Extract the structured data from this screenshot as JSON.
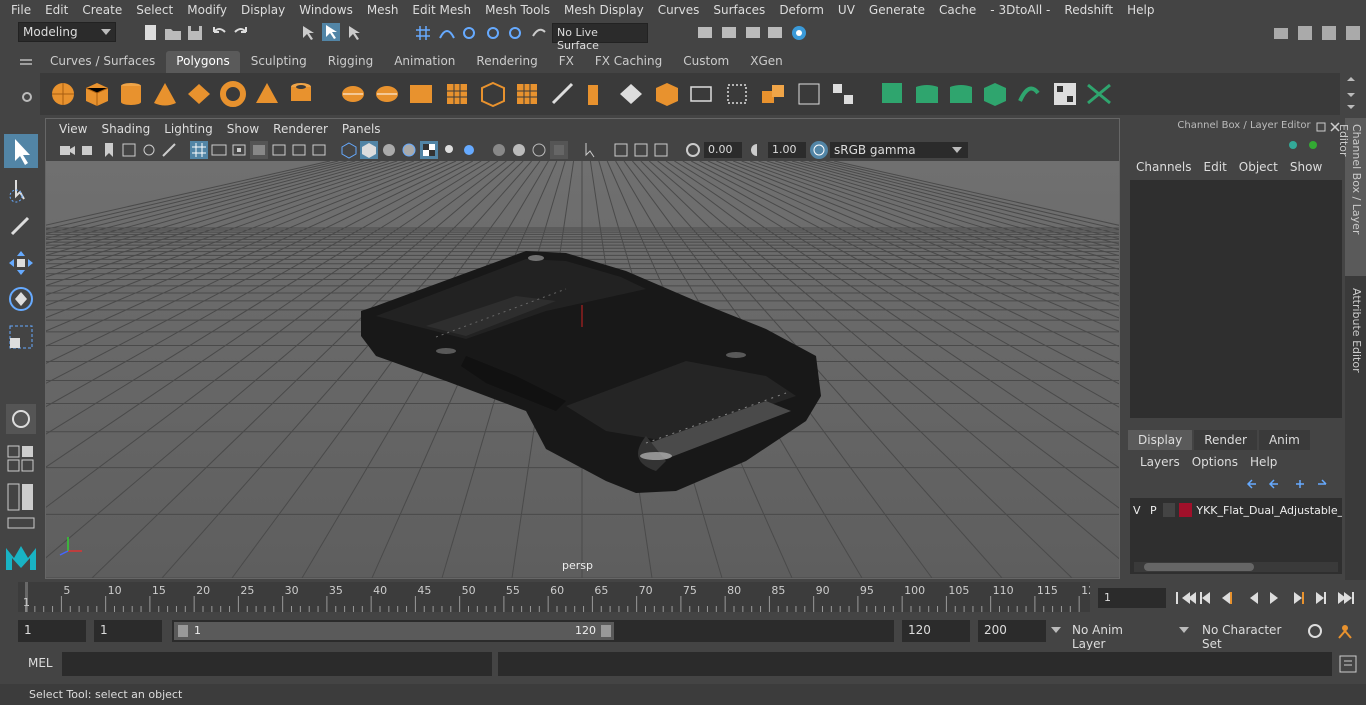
{
  "menubar": [
    "File",
    "Edit",
    "Create",
    "Select",
    "Modify",
    "Display",
    "Windows",
    "Mesh",
    "Edit Mesh",
    "Mesh Tools",
    "Mesh Display",
    "Curves",
    "Surfaces",
    "Deform",
    "UV",
    "Generate",
    "Cache",
    "- 3DtoAll -",
    "Redshift",
    "Help"
  ],
  "toolbar": {
    "mode": "Modeling",
    "live_surface": "No Live Surface"
  },
  "shelf_tabs": [
    "Curves / Surfaces",
    "Polygons",
    "Sculpting",
    "Rigging",
    "Animation",
    "Rendering",
    "FX",
    "FX Caching",
    "Custom",
    "XGen"
  ],
  "active_shelf_tab": "Polygons",
  "viewport": {
    "menu": [
      "View",
      "Shading",
      "Lighting",
      "Show",
      "Renderer",
      "Panels"
    ],
    "exposure": "0.00",
    "gamma": "1.00",
    "color_space": "sRGB gamma",
    "camera_label": "persp"
  },
  "right_panel": {
    "title": "Channel Box / Layer Editor",
    "channel_menu": [
      "Channels",
      "Edit",
      "Object",
      "Show"
    ],
    "layer_tabs": [
      "Display",
      "Render",
      "Anim"
    ],
    "active_layer_tab": "Display",
    "layer_menu": [
      "Layers",
      "Options",
      "Help"
    ],
    "layer": {
      "v": "V",
      "p": "P",
      "name": "YKK_Flat_Dual_Adjustable_",
      "color": "#a0102a"
    },
    "side_tabs": [
      "Channel Box / Layer Editor",
      "Attribute Editor"
    ]
  },
  "timeline": {
    "ticks": [
      "5",
      "10",
      "15",
      "20",
      "25",
      "30",
      "35",
      "40",
      "45",
      "50",
      "55",
      "60",
      "65",
      "70",
      "75",
      "80",
      "85",
      "90",
      "95",
      "100",
      "105",
      "110",
      "115",
      "12"
    ],
    "start_label": "1",
    "current_frame": "1"
  },
  "range": {
    "start": "1",
    "playback_start": "1",
    "slider_start": "1",
    "slider_end": "120",
    "playback_end": "120",
    "end": "200",
    "anim_layer": "No Anim Layer",
    "character_set": "No Character Set"
  },
  "cmdline": {
    "label": "MEL"
  },
  "status": {
    "text": "Select Tool: select an object"
  },
  "colors": {
    "accent": "#5285a6",
    "background": "#444444",
    "viewport": "#686868"
  }
}
